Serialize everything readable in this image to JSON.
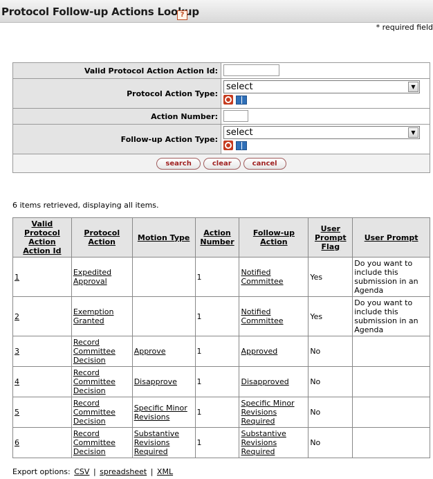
{
  "header": {
    "title": "Protocol Follow-up Actions Lookup",
    "help_glyph": "?",
    "required_note": "* required field"
  },
  "form": {
    "fields": [
      {
        "label": "Valid Protocol Action Action Id:",
        "value": ""
      },
      {
        "label": "Protocol Action Type:",
        "value": "select"
      },
      {
        "label": "Action Number:",
        "value": ""
      },
      {
        "label": "Follow-up Action Type:",
        "value": "select"
      }
    ],
    "buttons": {
      "search": "search",
      "clear": "clear",
      "cancel": "cancel"
    }
  },
  "results": {
    "message": "6 items retrieved, displaying all items.",
    "columns": [
      "Valid Protocol Action Action Id",
      "Protocol Action",
      "Motion Type",
      "Action Number",
      "Follow-up Action",
      "User Prompt Flag",
      "User Prompt"
    ],
    "rows": [
      {
        "id": "1",
        "protocol_action": "Expedited Approval",
        "motion_type": "",
        "action_number": "1",
        "followup_action": "Notified Committee",
        "flag": "Yes",
        "prompt": "Do you want to include this submission in an Agenda"
      },
      {
        "id": "2",
        "protocol_action": "Exemption Granted",
        "motion_type": "",
        "action_number": "1",
        "followup_action": "Notified Committee",
        "flag": "Yes",
        "prompt": "Do you want to include this submission in an Agenda"
      },
      {
        "id": "3",
        "protocol_action": "Record Committee Decision",
        "motion_type": "Approve",
        "action_number": "1",
        "followup_action": "Approved",
        "flag": "No",
        "prompt": ""
      },
      {
        "id": "4",
        "protocol_action": "Record Committee Decision",
        "motion_type": "Disapprove",
        "action_number": "1",
        "followup_action": "Disapproved",
        "flag": "No",
        "prompt": ""
      },
      {
        "id": "5",
        "protocol_action": "Record Committee Decision",
        "motion_type": "Specific Minor Revisions",
        "action_number": "1",
        "followup_action": "Specific Minor Revisions Required",
        "flag": "No",
        "prompt": ""
      },
      {
        "id": "6",
        "protocol_action": "Record Committee Decision",
        "motion_type": "Substantive Revisions Required",
        "action_number": "1",
        "followup_action": "Substantive Revisions Required",
        "flag": "No",
        "prompt": ""
      }
    ]
  },
  "export": {
    "label": "Export options:",
    "csv": "CSV",
    "spreadsheet": "spreadsheet",
    "xml": "XML",
    "separator": "|"
  }
}
